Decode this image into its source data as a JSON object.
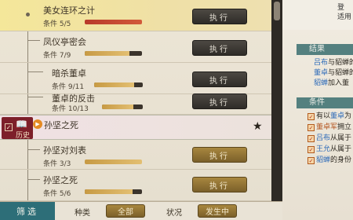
{
  "quests": [
    {
      "title": "美女连环之计",
      "cond_label": "条件",
      "progress": "5/5",
      "fill": 1.0,
      "bar": "red",
      "btn": "执行",
      "btn_style": "dark",
      "active": true
    },
    {
      "title": "凤仪亭密会",
      "cond_label": "条件",
      "progress": "7/9",
      "fill": 0.78,
      "bar": "gold",
      "btn": "执行",
      "btn_style": "dark",
      "active": false
    },
    {
      "title": "暗杀董卓",
      "cond_label": "条件",
      "progress": "9/11",
      "fill": 0.82,
      "bar": "gold",
      "btn": "执行",
      "btn_style": "dark",
      "active": false
    },
    {
      "title": "董卓的反击",
      "cond_label": "条件",
      "progress": "10/13",
      "fill": 0.77,
      "bar": "gold",
      "btn": "执行",
      "btn_style": "dark",
      "active": false
    }
  ],
  "history": {
    "badge_label": "历史",
    "title": "孙坚之死",
    "star": "★"
  },
  "sub_quests": [
    {
      "title": "孙坚对刘表",
      "cond_label": "条件",
      "progress": "3/3",
      "fill": 1.0,
      "bar": "gold",
      "btn": "执行",
      "btn_style": "gold"
    },
    {
      "title": "孙坚之死",
      "cond_label": "条件",
      "progress": "5/6",
      "fill": 0.83,
      "bar": "gold",
      "btn": "执行",
      "btn_style": "gold"
    }
  ],
  "filter": {
    "label": "筛选",
    "type_label": "种类",
    "type_value": "全部",
    "status_label": "状况",
    "status_value": "发生中"
  },
  "right_panel": {
    "top_line1": "登",
    "top_line2": "适用",
    "result_header": "结果",
    "results": [
      {
        "hl": "吕布",
        "text": "与貂蝉的"
      },
      {
        "hl": "董卓",
        "text": "与貂蝉的"
      },
      {
        "hl": "貂蝉",
        "text": "加入董"
      }
    ],
    "cond_header": "条件",
    "conditions": [
      {
        "pre": "有以",
        "hl": "董卓",
        "post": "为"
      },
      {
        "pre": "",
        "hl": "董卓军",
        "post": "拥立"
      },
      {
        "pre": "",
        "hl": "吕布",
        "post": "从属于"
      },
      {
        "pre": "",
        "hl": "王允",
        "post": "从属于"
      },
      {
        "pre": "",
        "hl": "貂蝉",
        "post": "的身份"
      }
    ]
  }
}
